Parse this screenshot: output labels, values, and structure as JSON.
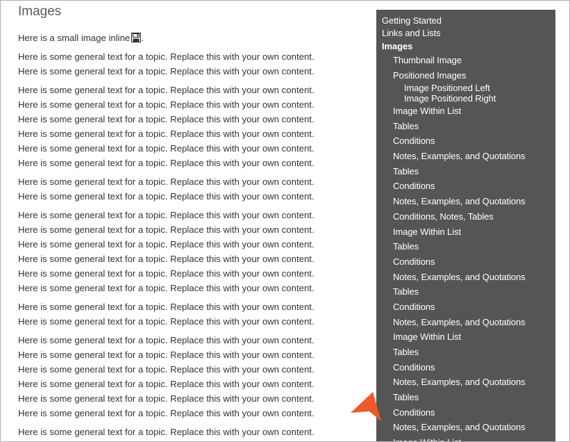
{
  "page": {
    "title": "Images",
    "inline_text": "Here is a small image inline",
    "paragraphs": [
      "Here is some general text for a topic. Replace this with your own content. Here is some general text for a topic. Replace this with your own content.",
      "Here is some general text for a topic. Replace this with your own content. Here is some general text for a topic. Replace this with your own content. Here is some general text for a topic. Replace this with your own content. Here is some general text for a topic. Replace this with your own content. Here is some general text for a topic. Replace this with your own content. Here is some general text for a topic. Replace this with your own content.",
      "Here is some general text for a topic. Replace this with your own content. Here is some general text for a topic. Replace this with your own content.",
      "Here is some general text for a topic. Replace this with your own content. Here is some general text for a topic. Replace this with your own content. Here is some general text for a topic. Replace this with your own content. Here is some general text for a topic. Replace this with your own content. Here is some general text for a topic. Replace this with your own content. Here is some general text for a topic. Replace this with your own content.",
      "Here is some general text for a topic. Replace this with your own content. Here is some general text for a topic. Replace this with your own content.",
      "Here is some general text for a topic. Replace this with your own content. Here is some general text for a topic. Replace this with your own content. Here is some general text for a topic. Replace this with your own content. Here is some general text for a topic. Replace this with your own content. Here is some general text for a topic. Replace this with your own content. Here is some general text for a topic. Replace this with your own content.",
      "Here is some general text for a topic. Replace this with your own content. Here is some general text for a topic. Replace this with your own content."
    ]
  },
  "icons": {
    "inline_image": "save-disk-icon",
    "pointer": "arrow-pointer-icon"
  },
  "colors": {
    "sidebar_bg": "#555555",
    "sidebar_text": "#ffffff",
    "pointer": "#f0582a",
    "body_text": "#333333",
    "title_text": "#5b5b5b"
  },
  "toc": [
    {
      "label": "Getting Started",
      "level": 0
    },
    {
      "label": "Links and Lists",
      "level": 0
    },
    {
      "label": "Images",
      "level": 0,
      "active": true
    },
    {
      "label": "Thumbnail Image",
      "level": 1
    },
    {
      "label": "Positioned Images",
      "level": 1
    },
    {
      "label": "Image Positioned Left",
      "level": 2
    },
    {
      "label": "Image Positioned Right",
      "level": 2
    },
    {
      "label": "Image Within List",
      "level": 1
    },
    {
      "label": "Tables",
      "level": 1
    },
    {
      "label": "Conditions",
      "level": 1
    },
    {
      "label": "Notes, Examples, and Quotations",
      "level": 1
    },
    {
      "label": "Tables",
      "level": 1
    },
    {
      "label": "Conditions",
      "level": 1
    },
    {
      "label": "Notes, Examples, and Quotations",
      "level": 1
    },
    {
      "label": "Conditions, Notes, Tables",
      "level": 1
    },
    {
      "label": "Image Within List",
      "level": 1
    },
    {
      "label": "Tables",
      "level": 1
    },
    {
      "label": "Conditions",
      "level": 1
    },
    {
      "label": "Notes, Examples, and Quotations",
      "level": 1
    },
    {
      "label": "Tables",
      "level": 1
    },
    {
      "label": "Conditions",
      "level": 1
    },
    {
      "label": "Notes, Examples, and Quotations",
      "level": 1
    },
    {
      "label": "Image Within List",
      "level": 1
    },
    {
      "label": "Tables",
      "level": 1
    },
    {
      "label": "Conditions",
      "level": 1
    },
    {
      "label": "Notes, Examples, and Quotations",
      "level": 1
    },
    {
      "label": "Tables",
      "level": 1
    },
    {
      "label": "Conditions",
      "level": 1
    },
    {
      "label": "Notes, Examples, and Quotations",
      "level": 1
    },
    {
      "label": "Image Within List",
      "level": 1
    }
  ]
}
